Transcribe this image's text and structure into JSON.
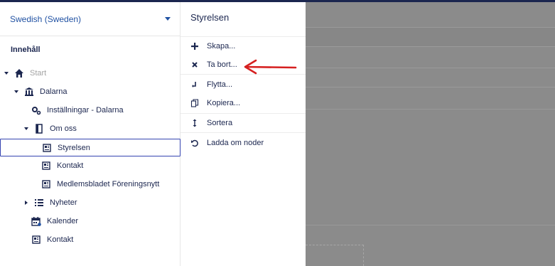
{
  "language_selector": {
    "value": "Swedish (Sweden)"
  },
  "tree": {
    "section_title": "Innehåll",
    "nodes": [
      {
        "label": "Start",
        "icon": "home-icon"
      },
      {
        "label": "Dalarna",
        "icon": "building-icon"
      },
      {
        "label": "Inställningar - Dalarna",
        "icon": "gears-icon"
      },
      {
        "label": "Om oss",
        "icon": "book-icon"
      },
      {
        "label": "Styrelsen",
        "icon": "newspaper-icon"
      },
      {
        "label": "Kontakt",
        "icon": "newspaper-icon"
      },
      {
        "label": "Medlemsbladet Föreningsnytt",
        "icon": "newspaper-icon"
      },
      {
        "label": "Nyheter",
        "icon": "list-icon"
      },
      {
        "label": "Kalender",
        "icon": "calendar-icon"
      },
      {
        "label": "Kontakt",
        "icon": "newspaper-icon"
      }
    ]
  },
  "actions": {
    "title": "Styrelsen",
    "items": [
      {
        "label": "Skapa...",
        "icon": "plus-icon"
      },
      {
        "label": "Ta bort...",
        "icon": "close-icon"
      },
      {
        "label": "Flytta...",
        "icon": "move-icon"
      },
      {
        "label": "Kopiera...",
        "icon": "copy-icon"
      },
      {
        "label": "Sortera",
        "icon": "sort-icon"
      },
      {
        "label": "Ladda om noder",
        "icon": "reload-icon"
      }
    ]
  },
  "colors": {
    "header_bar": "#1b264f",
    "link_blue": "#2152a3",
    "selection_border": "#3544b1",
    "annotation_red": "#d62020",
    "overlay_gray": "#8b8b8b"
  }
}
